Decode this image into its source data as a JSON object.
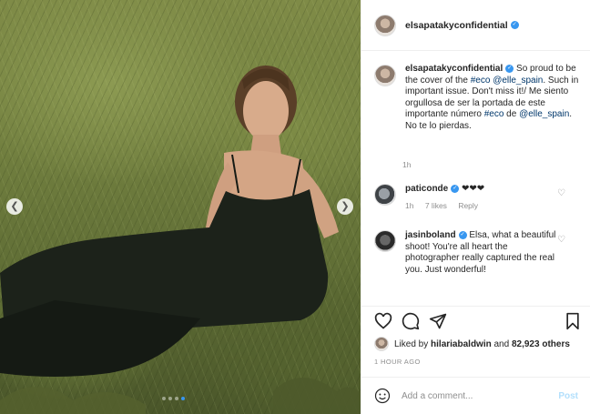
{
  "post": {
    "username": "elsapatakyconfidential",
    "caption": {
      "part1": "So proud to be the cover of the ",
      "hashtag1": "#eco",
      "mention1": "@elle_spain",
      "part2": ". Such in important issue. Don't miss it!/ Me siento orgullosa de ser la portada de este importante número ",
      "hashtag2": "#eco",
      "part3": " de ",
      "mention2": "@elle_spain",
      "part4": ". No te lo pierdas."
    },
    "caption_time": "1h"
  },
  "comments": [
    {
      "username": "paticonde",
      "text": "❤❤❤",
      "time": "1h",
      "likes": "7 likes",
      "reply": "Reply"
    },
    {
      "username": "jasinboland",
      "text": "Elsa, what a beautiful shoot! You're all heart the photographer really captured the real you. Just wonderful!"
    }
  ],
  "likes": {
    "prefix": "Liked by ",
    "user": "hilariabaldwin",
    "middle": " and ",
    "others": "82,923 others"
  },
  "timestamp": "1 HOUR AGO",
  "add_comment": {
    "placeholder": "Add a comment...",
    "post_label": "Post"
  },
  "carousel": {
    "count": 4,
    "active_index": 3
  },
  "colors": {
    "accent": "#3897f0",
    "link": "#00376b",
    "muted": "#8e8e8e",
    "post_disabled": "#b2dffc"
  }
}
